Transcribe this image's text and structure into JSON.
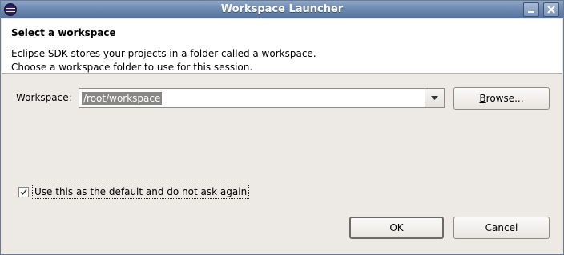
{
  "window": {
    "title": "Workspace Launcher",
    "icon": "eclipse-logo-icon",
    "controls": [
      "minimize-icon",
      "close-icon"
    ]
  },
  "header": {
    "title": "Select a workspace",
    "line1": "Eclipse SDK stores your projects in a folder called a workspace.",
    "line2": "Choose a workspace folder to use for this session."
  },
  "workspace": {
    "label_mnemonic": "W",
    "label_rest": "orkspace:",
    "value": "/root/workspace"
  },
  "browse": {
    "mnemonic": "B",
    "rest": "rowse..."
  },
  "default_checkbox": {
    "checked": true,
    "label": "Use this as the default and do not ask again"
  },
  "buttons": {
    "ok": "OK",
    "cancel": "Cancel"
  },
  "colors": {
    "titlebar": "#6f8bb3",
    "dialog_bg": "#edeae5",
    "header_bg": "#ffffff",
    "selection": "#888784"
  }
}
